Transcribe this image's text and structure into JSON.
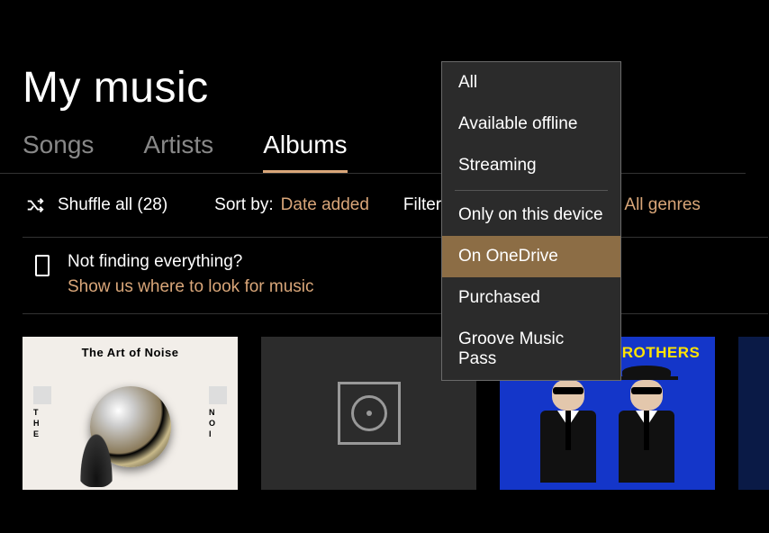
{
  "title": "My music",
  "tabs": [
    {
      "label": "Songs",
      "active": false
    },
    {
      "label": "Artists",
      "active": false
    },
    {
      "label": "Albums",
      "active": true
    }
  ],
  "toolbar": {
    "shuffle_label": "Shuffle all (28)",
    "sort_label": "Sort by:",
    "sort_value": "Date added",
    "filter_label": "Filter:",
    "genres_value": "All genres"
  },
  "hint": {
    "question": "Not finding everything?",
    "link": "Show us where to look for music"
  },
  "filter_dropdown": {
    "items": [
      "All",
      "Available offline",
      "Streaming",
      "Only on this device",
      "On OneDrive",
      "Purchased",
      "Groove Music Pass"
    ],
    "selected": "On OneDrive",
    "separator_after_index": 2
  },
  "albums": [
    {
      "title": "The Art of Noise"
    },
    {
      "title": ""
    },
    {
      "title": "THE BLUES BROTHERS"
    },
    {
      "title": ""
    }
  ]
}
